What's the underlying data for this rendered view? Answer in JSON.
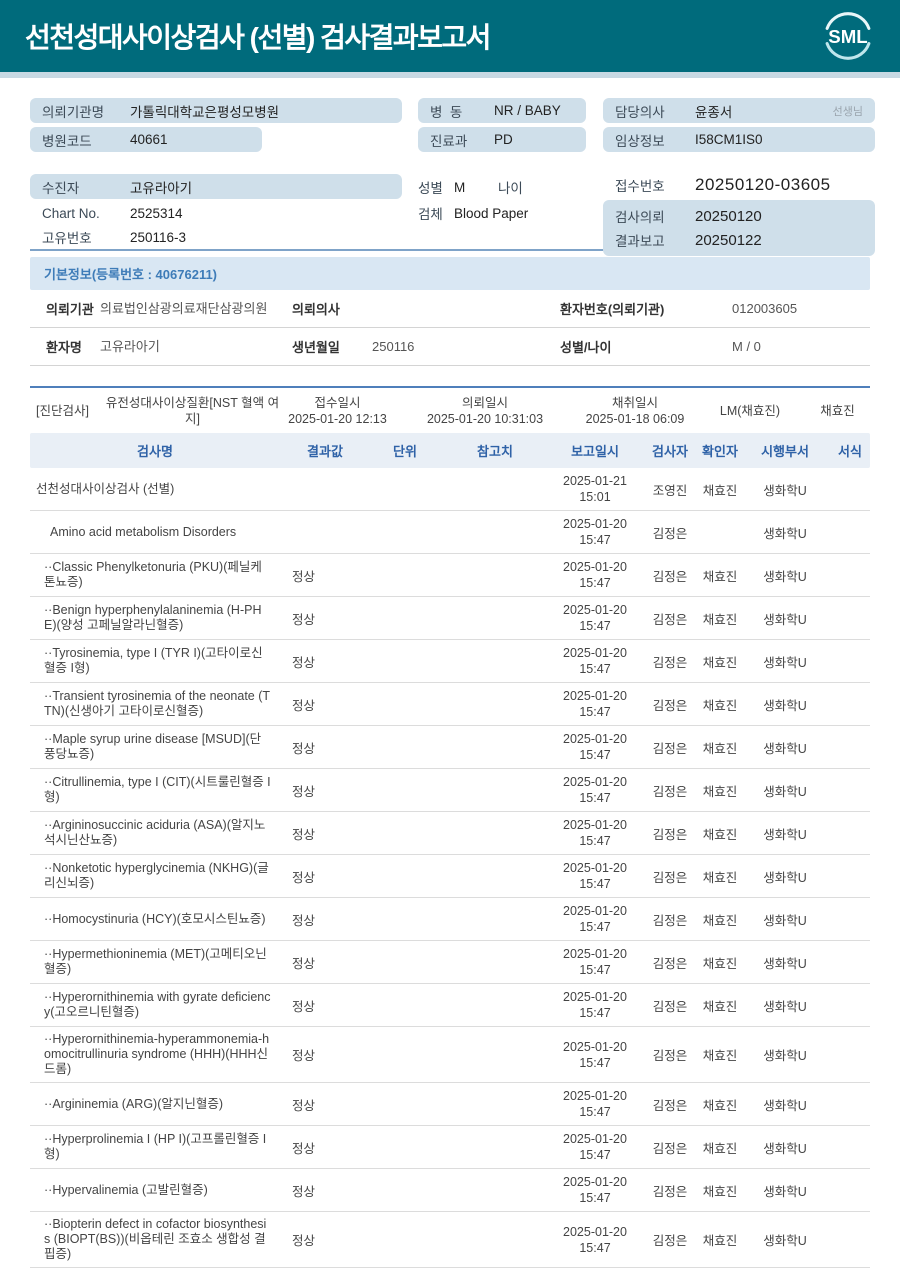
{
  "colors": {
    "banner_teal": "#006b7c",
    "strip_blue": "#c7d9e3",
    "field_bar": "#cfdfea",
    "basic_bar_bg": "#d9e7f3",
    "basic_bar_text": "#3e7cb8",
    "table_header_bg": "#e9eff6",
    "table_header_text": "#2f62a7"
  },
  "banner": {
    "title": "선천성대사이상검사 (선별) 검사결과보고서",
    "logo_text": "SML"
  },
  "header_fields": {
    "left": {
      "org_label": "의뢰기관명",
      "org_value": "가톨릭대학교은평성모병원",
      "code_label": "병원코드",
      "code_value": "40661",
      "patient_label": "수진자",
      "patient_value": "고유라아기",
      "chart_label": "Chart No.",
      "chart_value": "2525314",
      "unique_label": "고유번호",
      "unique_value": "250116-3"
    },
    "middle": {
      "ward_label": "병  동",
      "ward_value": "NR / BABY",
      "dept_label": "진료과",
      "dept_value": "PD",
      "sex_label": "성별",
      "sex_value": "M",
      "age_label": "나이",
      "specimen_label": "검체",
      "specimen_value": "Blood Paper"
    },
    "right": {
      "doctor_label": "담당의사",
      "doctor_value": "윤종서",
      "doctor_suffix": "선생님",
      "clinical_label": "임상정보",
      "clinical_value": "I58CM1IS0",
      "receipt_label": "접수번호",
      "receipt_value": "20250120-03605",
      "request_label": "검사의뢰",
      "request_value": "20250120",
      "report_label": "결과보고",
      "report_value": "20250122"
    }
  },
  "basic_info": {
    "title": "기본정보(등록번호 : 40676211)",
    "rows": [
      {
        "c1l": "의뢰기관",
        "c1v": "의료법인삼광의료재단삼광의원",
        "c2l": "의뢰의사",
        "c2v": "",
        "c3l": "환자번호(의뢰기관)",
        "c3v": "012003605"
      },
      {
        "c1l": "환자명",
        "c1v": "고유라아기",
        "c2l": "생년월일",
        "c2v": "250116",
        "c3l": "성별/나이",
        "c3v": "M / 0"
      }
    ]
  },
  "order_info": {
    "tag": "[진단검사]",
    "test_group": "유전성대사이상질환[NST 혈액 여지]",
    "receipt_time_label": "접수일시",
    "receipt_time": "2025-01-20 12:13",
    "request_time_label": "의뢰일시",
    "request_time": "2025-01-20 10:31:03",
    "collect_time_label": "채취일시",
    "collect_time": "2025-01-18 06:09",
    "lab": "LM(채효진)",
    "collector": "채효진"
  },
  "results_table": {
    "headers": [
      "검사명",
      "결과값",
      "단위",
      "참고치",
      "보고일시",
      "검사자",
      "확인자",
      "시행부서",
      "서식"
    ],
    "rows": [
      {
        "name": "선천성대사이상검사 (선별)",
        "indent": 0,
        "result": "",
        "date": "2025-01-21",
        "time": "15:01",
        "tester": "조영진",
        "checker": "채효진",
        "dept": "생화학U"
      },
      {
        "name": "Amino acid metabolism Disorders",
        "indent": 1,
        "result": "",
        "date": "2025-01-20",
        "time": "15:47",
        "tester": "김정은",
        "checker": "",
        "dept": "생화학U"
      },
      {
        "name": "··Classic Phenylketonuria (PKU)(페닐케톤뇨증)",
        "indent": 2,
        "result": "정상",
        "date": "2025-01-20",
        "time": "15:47",
        "tester": "김정은",
        "checker": "채효진",
        "dept": "생화학U"
      },
      {
        "name": "··Benign hyperphenylalaninemia (H-PHE)(양성 고페닐알라닌혈증)",
        "indent": 2,
        "result": "정상",
        "date": "2025-01-20",
        "time": "15:47",
        "tester": "김정은",
        "checker": "채효진",
        "dept": "생화학U"
      },
      {
        "name": "··Tyrosinemia, type I (TYR I)(고타이로신혈증 I형)",
        "indent": 2,
        "result": "정상",
        "date": "2025-01-20",
        "time": "15:47",
        "tester": "김정은",
        "checker": "채효진",
        "dept": "생화학U"
      },
      {
        "name": "··Transient tyrosinemia of the neonate (TTN)(신생아기 고타이로신혈증)",
        "indent": 2,
        "result": "정상",
        "date": "2025-01-20",
        "time": "15:47",
        "tester": "김정은",
        "checker": "채효진",
        "dept": "생화학U"
      },
      {
        "name": "··Maple syrup urine disease [MSUD](단풍당뇨증)",
        "indent": 2,
        "result": "정상",
        "date": "2025-01-20",
        "time": "15:47",
        "tester": "김정은",
        "checker": "채효진",
        "dept": "생화학U"
      },
      {
        "name": "··Citrullinemia, type I (CIT)(시트룰린혈증 I형)",
        "indent": 2,
        "result": "정상",
        "date": "2025-01-20",
        "time": "15:47",
        "tester": "김정은",
        "checker": "채효진",
        "dept": "생화학U"
      },
      {
        "name": "··Argininosuccinic aciduria (ASA)(알지노석시닌산뇨증)",
        "indent": 2,
        "result": "정상",
        "date": "2025-01-20",
        "time": "15:47",
        "tester": "김정은",
        "checker": "채효진",
        "dept": "생화학U"
      },
      {
        "name": "··Nonketotic hyperglycinemia (NKHG)(글리신뇌증)",
        "indent": 2,
        "result": "정상",
        "date": "2025-01-20",
        "time": "15:47",
        "tester": "김정은",
        "checker": "채효진",
        "dept": "생화학U"
      },
      {
        "name": "··Homocystinuria (HCY)(호모시스틴뇨증)",
        "indent": 2,
        "result": "정상",
        "date": "2025-01-20",
        "time": "15:47",
        "tester": "김정은",
        "checker": "채효진",
        "dept": "생화학U"
      },
      {
        "name": "··Hypermethioninemia (MET)(고메티오닌혈증)",
        "indent": 2,
        "result": "정상",
        "date": "2025-01-20",
        "time": "15:47",
        "tester": "김정은",
        "checker": "채효진",
        "dept": "생화학U"
      },
      {
        "name": "··Hyperornithinemia with gyrate deficiency(고오르니틴혈증)",
        "indent": 2,
        "result": "정상",
        "date": "2025-01-20",
        "time": "15:47",
        "tester": "김정은",
        "checker": "채효진",
        "dept": "생화학U"
      },
      {
        "name": "··Hyperornithinemia-hyperammonemia-homocitrullinuria syndrome (HHH)(HHH신드롬)",
        "indent": 2,
        "result": "정상",
        "date": "2025-01-20",
        "time": "15:47",
        "tester": "김정은",
        "checker": "채효진",
        "dept": "생화학U"
      },
      {
        "name": "··Argininemia (ARG)(알지닌혈증)",
        "indent": 2,
        "result": "정상",
        "date": "2025-01-20",
        "time": "15:47",
        "tester": "김정은",
        "checker": "채효진",
        "dept": "생화학U"
      },
      {
        "name": "··Hyperprolinemia I (HP I)(고프롤린혈증 I형)",
        "indent": 2,
        "result": "정상",
        "date": "2025-01-20",
        "time": "15:47",
        "tester": "김정은",
        "checker": "채효진",
        "dept": "생화학U"
      },
      {
        "name": "··Hypervalinemia (고발린혈증)",
        "indent": 2,
        "result": "정상",
        "date": "2025-01-20",
        "time": "15:47",
        "tester": "김정은",
        "checker": "채효진",
        "dept": "생화학U"
      },
      {
        "name": "··Biopterin defect in cofactor biosynthesis (BIOPT(BS))(비옵테린 조효소 생합성 결핍증)",
        "indent": 2,
        "result": "정상",
        "date": "2025-01-20",
        "time": "15:47",
        "tester": "김정은",
        "checker": "채효진",
        "dept": "생화학U"
      }
    ]
  }
}
